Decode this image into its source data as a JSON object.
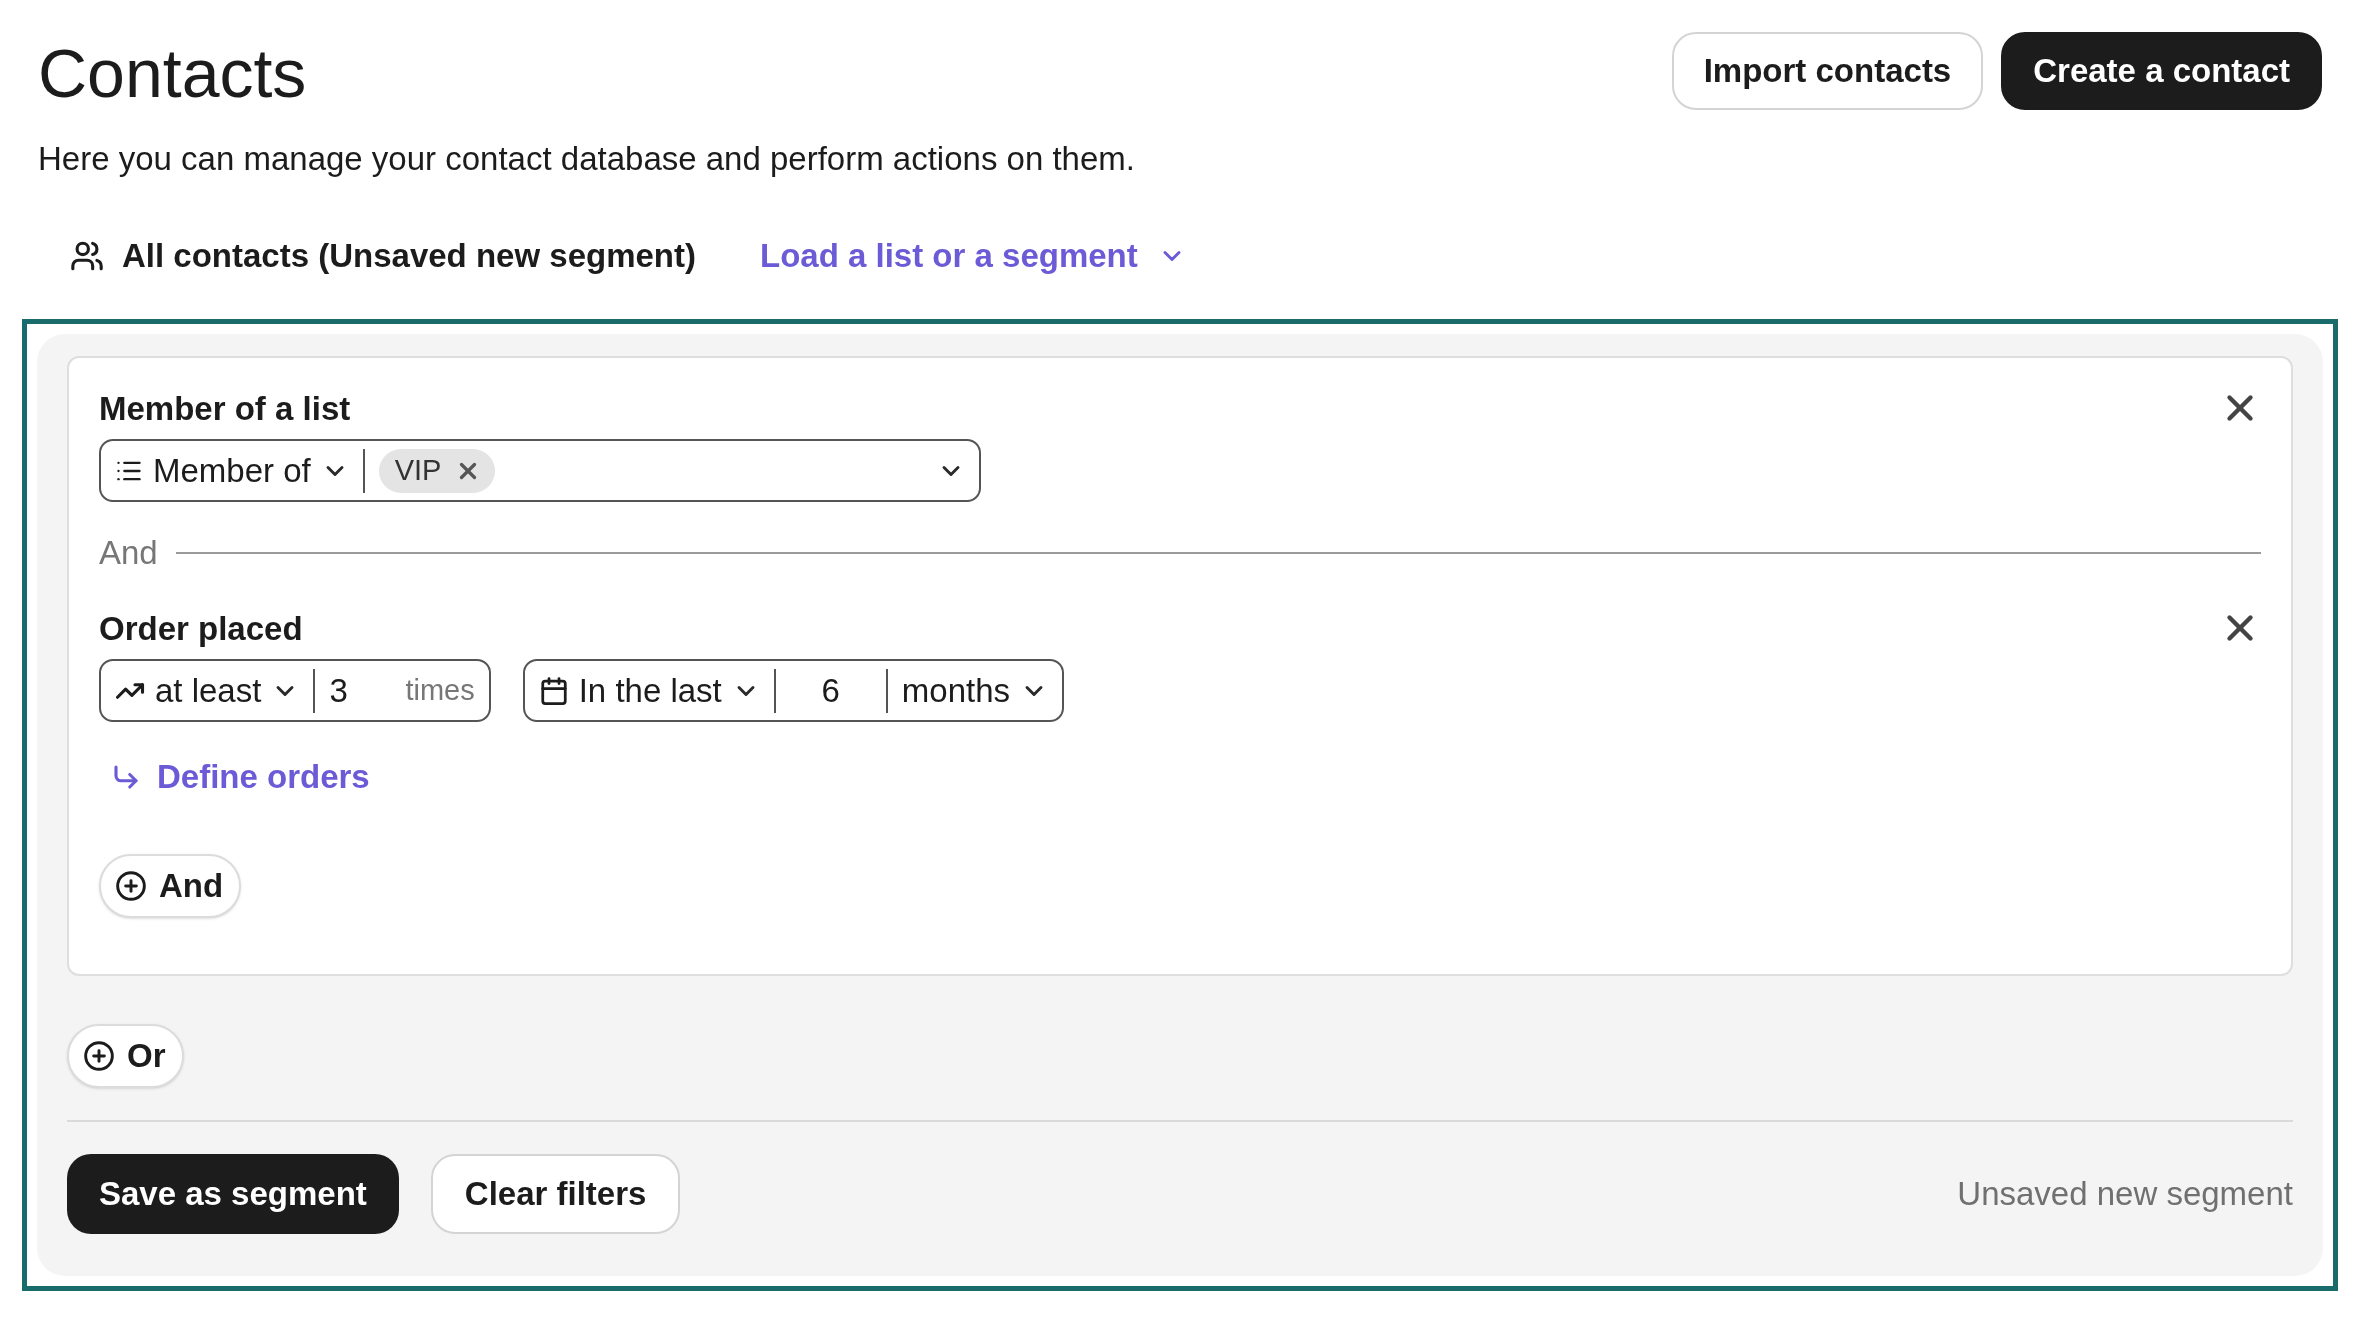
{
  "header": {
    "title": "Contacts",
    "buttons": [
      {
        "label": "Import contacts",
        "kind": "secondary"
      },
      {
        "label": "Create a contact",
        "kind": "primary"
      }
    ]
  },
  "description": "Here you can manage your contact database and perform actions on them.",
  "segment_bar": {
    "current": "All contacts (Unsaved new segment)",
    "load_link": "Load a list or a segment"
  },
  "filter_groups": [
    {
      "connector": "And",
      "add_button": "And",
      "conditions": [
        {
          "kind": "list",
          "title": "Member of a list",
          "operator": "Member of",
          "tags": [
            "VIP"
          ]
        },
        {
          "kind": "order",
          "title": "Order placed",
          "comparison": "at least",
          "count": "3",
          "count_unit": "times",
          "period": "In the last",
          "period_value": "6",
          "period_unit": "months",
          "link": "Define orders"
        }
      ]
    }
  ],
  "add_group_button": "Or",
  "footer": {
    "save_button": "Save as segment",
    "clear_button": "Clear filters",
    "status": "Unsaved new segment"
  }
}
